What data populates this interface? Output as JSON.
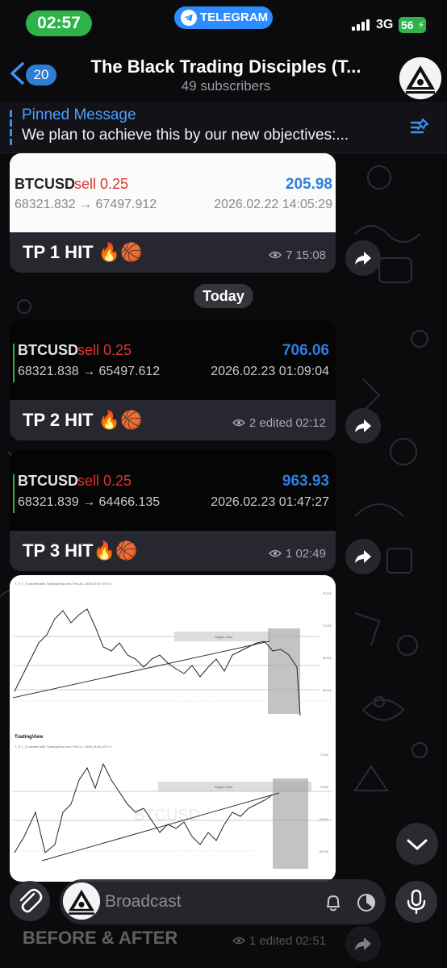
{
  "status_bar": {
    "time": "02:57",
    "app_pill": "TELEGRAM",
    "network": "3G",
    "battery": "56"
  },
  "header": {
    "back_count": "20",
    "title": "The Black Trading Disciples (T...",
    "subtitle": "49 subscribers"
  },
  "pinned": {
    "label": "Pinned Message",
    "text": "We plan to achieve this by our new objectives:..."
  },
  "messages": [
    {
      "symbol": "BTCUSD",
      "side": "sell 0.25",
      "profit": "205.98",
      "prices": "68321.832 → 67497.912",
      "datetime": "2026.02.22 14:05:29",
      "caption": "TP 1 HIT 🔥🏀",
      "views": "7",
      "time": "15:08"
    },
    {
      "symbol": "BTCUSD",
      "side": "sell 0.25",
      "profit": "706.06",
      "prices": "68321.838 → 65497.612",
      "datetime": "2026.02.23 01:09:04",
      "caption": "TP 2 HIT 🔥🏀",
      "views": "2",
      "time": "edited 02:12"
    },
    {
      "symbol": "BTCUSD",
      "side": "sell 0.25",
      "profit": "963.93",
      "prices": "68321.839 → 64466.135",
      "datetime": "2026.02.23 01:47:27",
      "caption": "TP 3 HIT🔥🏀",
      "views": "1",
      "time": "02:49"
    }
  ],
  "date_separator": "Today",
  "chart_message": {
    "chart1_header": "T_S T_S created with TradingView.com, Feb 23, 2026 02:57 UTC+1",
    "chart1_zone": "Supply Zone",
    "chart2_logo": "TradingView",
    "chart2_header": "T_S T_S created with TradingView.com, Feb 21, 2026 23:46 UTC+1",
    "chart2_zone": "Supply Zone",
    "watermark": "BTCUSD",
    "caption": "BEFORE & AFTER",
    "views": "1",
    "time": "edited 02:51"
  },
  "composer": {
    "placeholder": "Broadcast"
  },
  "colors": {
    "accent_blue": "#2d8cff",
    "green": "#2db34a",
    "sell_red": "#e0332c",
    "profit_blue": "#2f7fe0"
  },
  "icons": [
    "telegram-plane-icon",
    "signal-icon",
    "back-chevron-icon",
    "pin-list-icon",
    "eye-icon",
    "forward-icon",
    "chevron-down-icon",
    "paperclip-icon",
    "bell-icon",
    "timer-icon",
    "microphone-icon"
  ]
}
